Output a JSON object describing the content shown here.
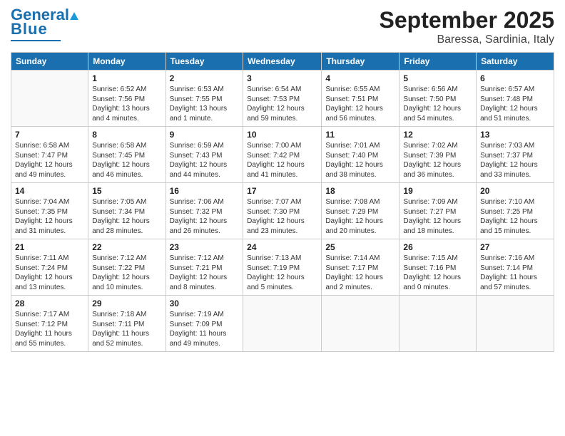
{
  "header": {
    "logo_general": "General",
    "logo_blue": "Blue",
    "month_title": "September 2025",
    "location": "Baressa, Sardinia, Italy"
  },
  "days_of_week": [
    "Sunday",
    "Monday",
    "Tuesday",
    "Wednesday",
    "Thursday",
    "Friday",
    "Saturday"
  ],
  "weeks": [
    [
      {
        "day": "",
        "info": ""
      },
      {
        "day": "1",
        "info": "Sunrise: 6:52 AM\nSunset: 7:56 PM\nDaylight: 13 hours\nand 4 minutes."
      },
      {
        "day": "2",
        "info": "Sunrise: 6:53 AM\nSunset: 7:55 PM\nDaylight: 13 hours\nand 1 minute."
      },
      {
        "day": "3",
        "info": "Sunrise: 6:54 AM\nSunset: 7:53 PM\nDaylight: 12 hours\nand 59 minutes."
      },
      {
        "day": "4",
        "info": "Sunrise: 6:55 AM\nSunset: 7:51 PM\nDaylight: 12 hours\nand 56 minutes."
      },
      {
        "day": "5",
        "info": "Sunrise: 6:56 AM\nSunset: 7:50 PM\nDaylight: 12 hours\nand 54 minutes."
      },
      {
        "day": "6",
        "info": "Sunrise: 6:57 AM\nSunset: 7:48 PM\nDaylight: 12 hours\nand 51 minutes."
      }
    ],
    [
      {
        "day": "7",
        "info": "Sunrise: 6:58 AM\nSunset: 7:47 PM\nDaylight: 12 hours\nand 49 minutes."
      },
      {
        "day": "8",
        "info": "Sunrise: 6:58 AM\nSunset: 7:45 PM\nDaylight: 12 hours\nand 46 minutes."
      },
      {
        "day": "9",
        "info": "Sunrise: 6:59 AM\nSunset: 7:43 PM\nDaylight: 12 hours\nand 44 minutes."
      },
      {
        "day": "10",
        "info": "Sunrise: 7:00 AM\nSunset: 7:42 PM\nDaylight: 12 hours\nand 41 minutes."
      },
      {
        "day": "11",
        "info": "Sunrise: 7:01 AM\nSunset: 7:40 PM\nDaylight: 12 hours\nand 38 minutes."
      },
      {
        "day": "12",
        "info": "Sunrise: 7:02 AM\nSunset: 7:39 PM\nDaylight: 12 hours\nand 36 minutes."
      },
      {
        "day": "13",
        "info": "Sunrise: 7:03 AM\nSunset: 7:37 PM\nDaylight: 12 hours\nand 33 minutes."
      }
    ],
    [
      {
        "day": "14",
        "info": "Sunrise: 7:04 AM\nSunset: 7:35 PM\nDaylight: 12 hours\nand 31 minutes."
      },
      {
        "day": "15",
        "info": "Sunrise: 7:05 AM\nSunset: 7:34 PM\nDaylight: 12 hours\nand 28 minutes."
      },
      {
        "day": "16",
        "info": "Sunrise: 7:06 AM\nSunset: 7:32 PM\nDaylight: 12 hours\nand 26 minutes."
      },
      {
        "day": "17",
        "info": "Sunrise: 7:07 AM\nSunset: 7:30 PM\nDaylight: 12 hours\nand 23 minutes."
      },
      {
        "day": "18",
        "info": "Sunrise: 7:08 AM\nSunset: 7:29 PM\nDaylight: 12 hours\nand 20 minutes."
      },
      {
        "day": "19",
        "info": "Sunrise: 7:09 AM\nSunset: 7:27 PM\nDaylight: 12 hours\nand 18 minutes."
      },
      {
        "day": "20",
        "info": "Sunrise: 7:10 AM\nSunset: 7:25 PM\nDaylight: 12 hours\nand 15 minutes."
      }
    ],
    [
      {
        "day": "21",
        "info": "Sunrise: 7:11 AM\nSunset: 7:24 PM\nDaylight: 12 hours\nand 13 minutes."
      },
      {
        "day": "22",
        "info": "Sunrise: 7:12 AM\nSunset: 7:22 PM\nDaylight: 12 hours\nand 10 minutes."
      },
      {
        "day": "23",
        "info": "Sunrise: 7:12 AM\nSunset: 7:21 PM\nDaylight: 12 hours\nand 8 minutes."
      },
      {
        "day": "24",
        "info": "Sunrise: 7:13 AM\nSunset: 7:19 PM\nDaylight: 12 hours\nand 5 minutes."
      },
      {
        "day": "25",
        "info": "Sunrise: 7:14 AM\nSunset: 7:17 PM\nDaylight: 12 hours\nand 2 minutes."
      },
      {
        "day": "26",
        "info": "Sunrise: 7:15 AM\nSunset: 7:16 PM\nDaylight: 12 hours\nand 0 minutes."
      },
      {
        "day": "27",
        "info": "Sunrise: 7:16 AM\nSunset: 7:14 PM\nDaylight: 11 hours\nand 57 minutes."
      }
    ],
    [
      {
        "day": "28",
        "info": "Sunrise: 7:17 AM\nSunset: 7:12 PM\nDaylight: 11 hours\nand 55 minutes."
      },
      {
        "day": "29",
        "info": "Sunrise: 7:18 AM\nSunset: 7:11 PM\nDaylight: 11 hours\nand 52 minutes."
      },
      {
        "day": "30",
        "info": "Sunrise: 7:19 AM\nSunset: 7:09 PM\nDaylight: 11 hours\nand 49 minutes."
      },
      {
        "day": "",
        "info": ""
      },
      {
        "day": "",
        "info": ""
      },
      {
        "day": "",
        "info": ""
      },
      {
        "day": "",
        "info": ""
      }
    ]
  ]
}
